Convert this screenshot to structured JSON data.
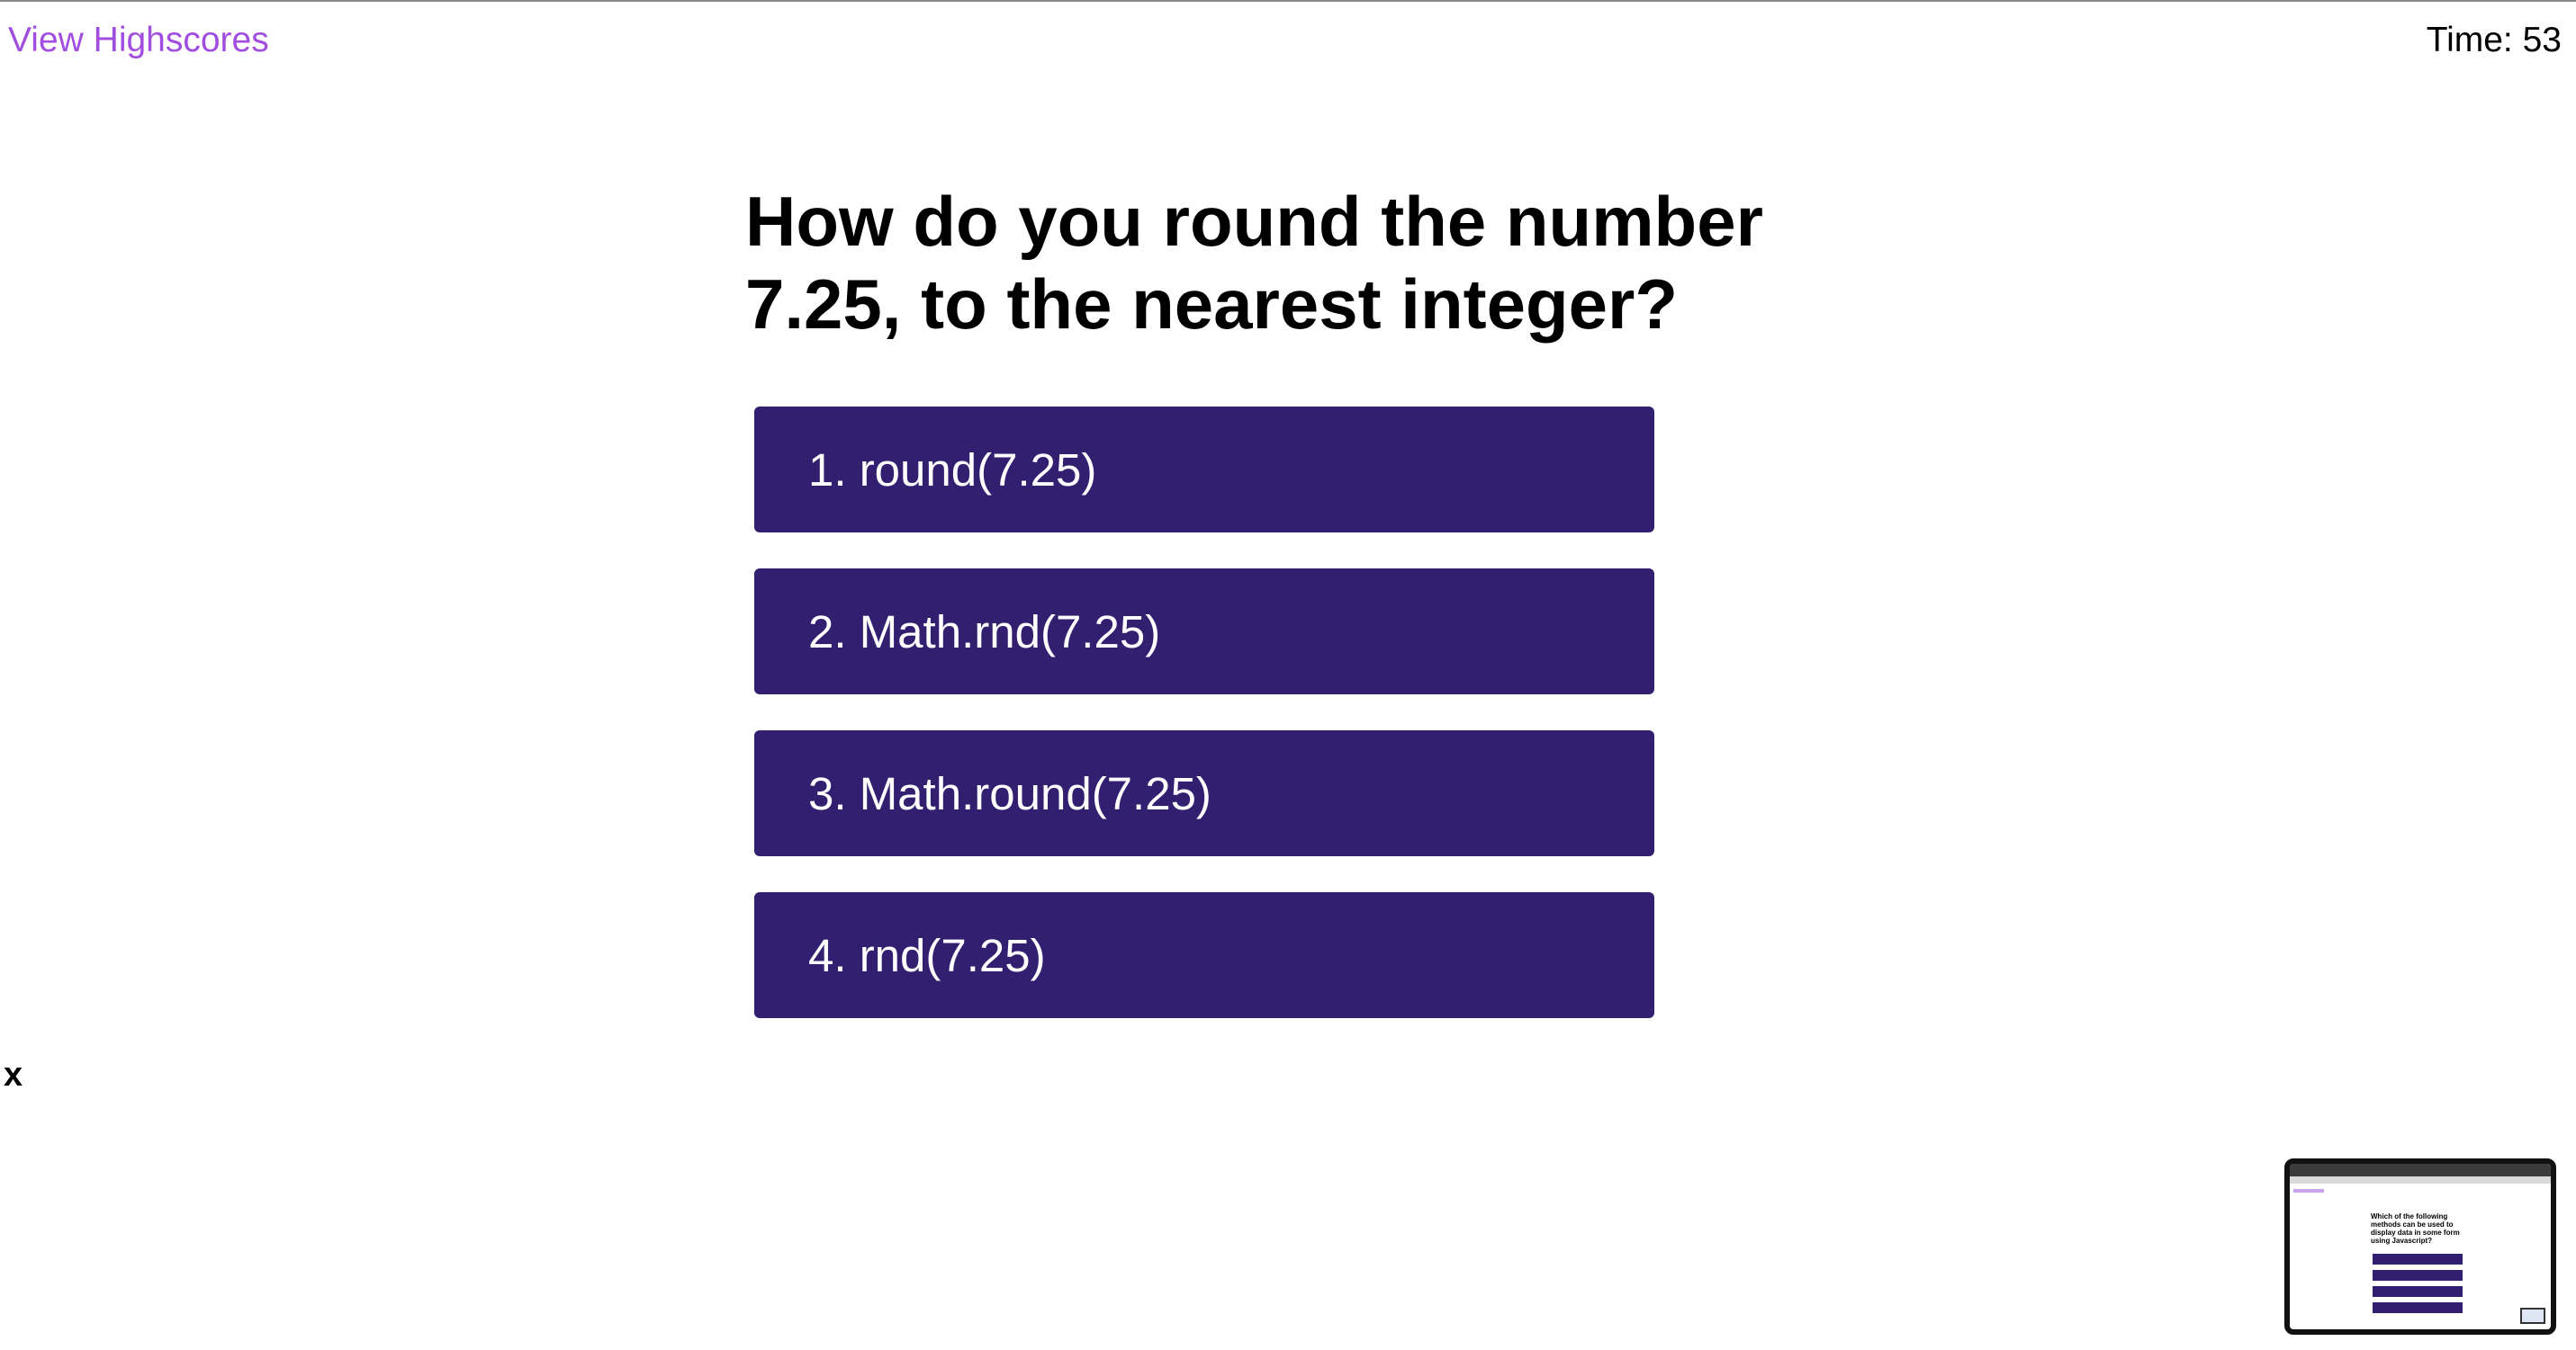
{
  "header": {
    "highscores_link": "View Highscores",
    "timer": "Time: 53"
  },
  "quiz": {
    "question": "How do you round the number 7.25, to the nearest integer?",
    "choices": [
      "1. round(7.25)",
      "2. Math.rnd(7.25)",
      "3. Math.round(7.25)",
      "4. rnd(7.25)"
    ]
  },
  "feedback": {
    "close_label": "x"
  },
  "thumbnail": {
    "question": "Which of the following methods can be used to display data in some form using Javascript?"
  },
  "colors": {
    "link": "#a14ee0",
    "choice_background": "#331f70",
    "choice_text": "#ffffff",
    "text": "#000000"
  }
}
